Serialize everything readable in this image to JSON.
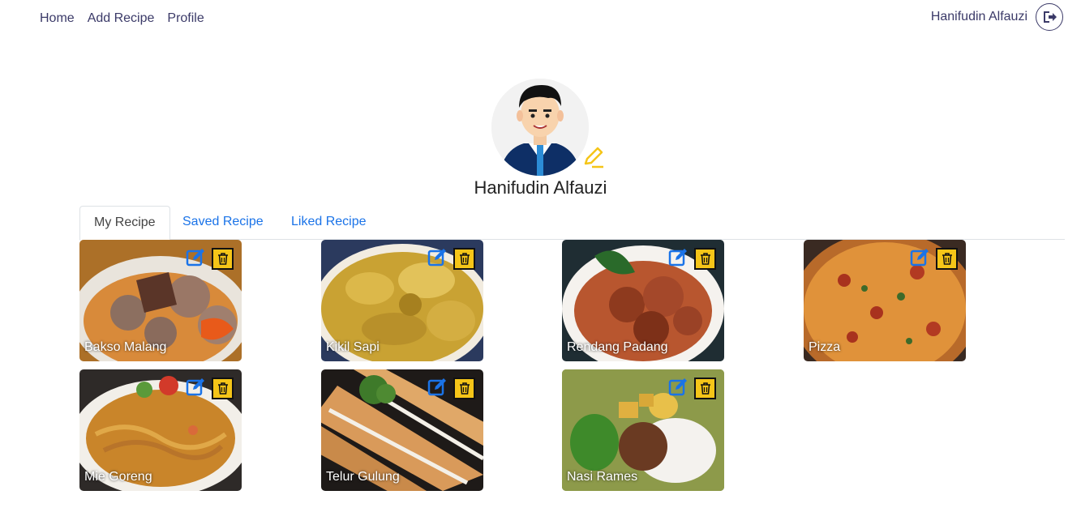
{
  "nav": {
    "home": "Home",
    "add_recipe": "Add Recipe",
    "profile": "Profile"
  },
  "user": {
    "name": "Hanifudin Alfauzi",
    "logout_icon": "logout-icon"
  },
  "profile": {
    "name": "Hanifudin Alfauzi",
    "edit_icon": "pencil-icon"
  },
  "tabs": [
    {
      "label": "My Recipe",
      "active": true
    },
    {
      "label": "Saved Recipe",
      "active": false
    },
    {
      "label": "Liked Recipe",
      "active": false
    }
  ],
  "recipes": [
    {
      "title": "Bakso Malang"
    },
    {
      "title": "Kikil Sapi"
    },
    {
      "title": "Rendang Padang"
    },
    {
      "title": "Pizza"
    },
    {
      "title": "Mie Goreng"
    },
    {
      "title": "Telur Gulung"
    },
    {
      "title": "Nasi Rames"
    }
  ],
  "colors": {
    "nav_text": "#3b3a68",
    "tab_link": "#1a73e8",
    "delete_bg": "#f5c518",
    "edit_icon": "#1a73e8",
    "pencil": "#f5c518"
  }
}
